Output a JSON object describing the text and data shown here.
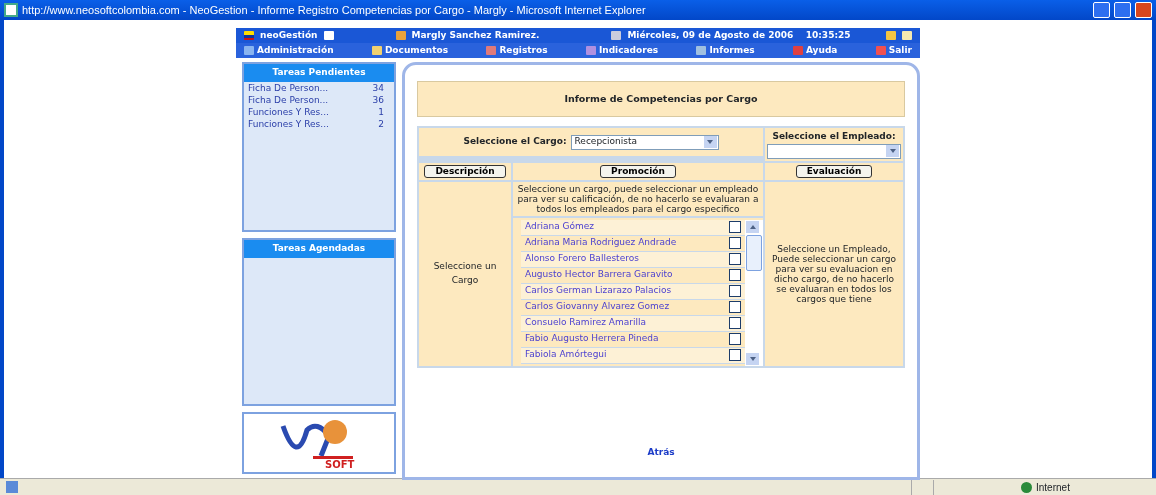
{
  "window": {
    "title": "http://www.neosoftcolombia.com - NeoGestion - Informe Registro Competencias por Cargo - Margly  - Microsoft Internet Explorer"
  },
  "header": {
    "app": "neoGestión",
    "user": "Margly Sanchez Ramirez.",
    "date": "Miércoles, 09 de Agosto de 2006    10:35:25"
  },
  "menu": [
    "Administración",
    "Documentos",
    "Registros",
    "Indicadores",
    "Informes",
    "Ayuda",
    "Salir"
  ],
  "sidebar": {
    "pending_title": "Tareas Pendientes",
    "pending": [
      {
        "label": "Ficha De Person...",
        "count": "34"
      },
      {
        "label": "Ficha De Person...",
        "count": "36"
      },
      {
        "label": "Funciones Y Res...",
        "count": "1"
      },
      {
        "label": "Funciones Y Res...",
        "count": "2"
      }
    ],
    "scheduled_title": "Tareas Agendadas",
    "logo_text": "SOFT"
  },
  "report": {
    "title": "Informe de Competencias por Cargo",
    "cargo_label": "Seleccione el Cargo:",
    "cargo_value": "Recepcionista",
    "empleado_label": "Seleccione el Empleado:",
    "buttons": [
      "Descripción",
      "Promoción",
      "Evaluación"
    ],
    "left_note": "Seleccione un Cargo",
    "middle_note": "Seleccione un cargo, puede seleccionar un empleado para ver su calificación, de no hacerlo se evaluaran a todos los empleados para el cargo especifico",
    "right_note": "Seleccione un Empleado, Puede seleccionar un cargo para ver su evaluacion en dicho cargo, de no hacerlo se evaluaran en todos los cargos que tiene",
    "employees": [
      {
        "name": "Adriana Gómez",
        "checked": false
      },
      {
        "name": "Adriana Maria Rodriguez Andrade",
        "checked": false
      },
      {
        "name": "Alonso Forero Ballesteros",
        "checked": false
      },
      {
        "name": "Augusto Hector Barrera Garavito",
        "checked": false
      },
      {
        "name": "Carlos German Lizarazo Palacios",
        "checked": false
      },
      {
        "name": "Carlos Giovanny Alvarez Gomez",
        "checked": false
      },
      {
        "name": "Consuelo Ramirez Amarilla",
        "checked": false
      },
      {
        "name": "Fabio Augusto Herrera Pineda",
        "checked": false
      },
      {
        "name": "Fabiola Amórtegui",
        "checked": false
      }
    ],
    "back": "Atrás"
  },
  "status_bar": {
    "zone": "Internet"
  }
}
